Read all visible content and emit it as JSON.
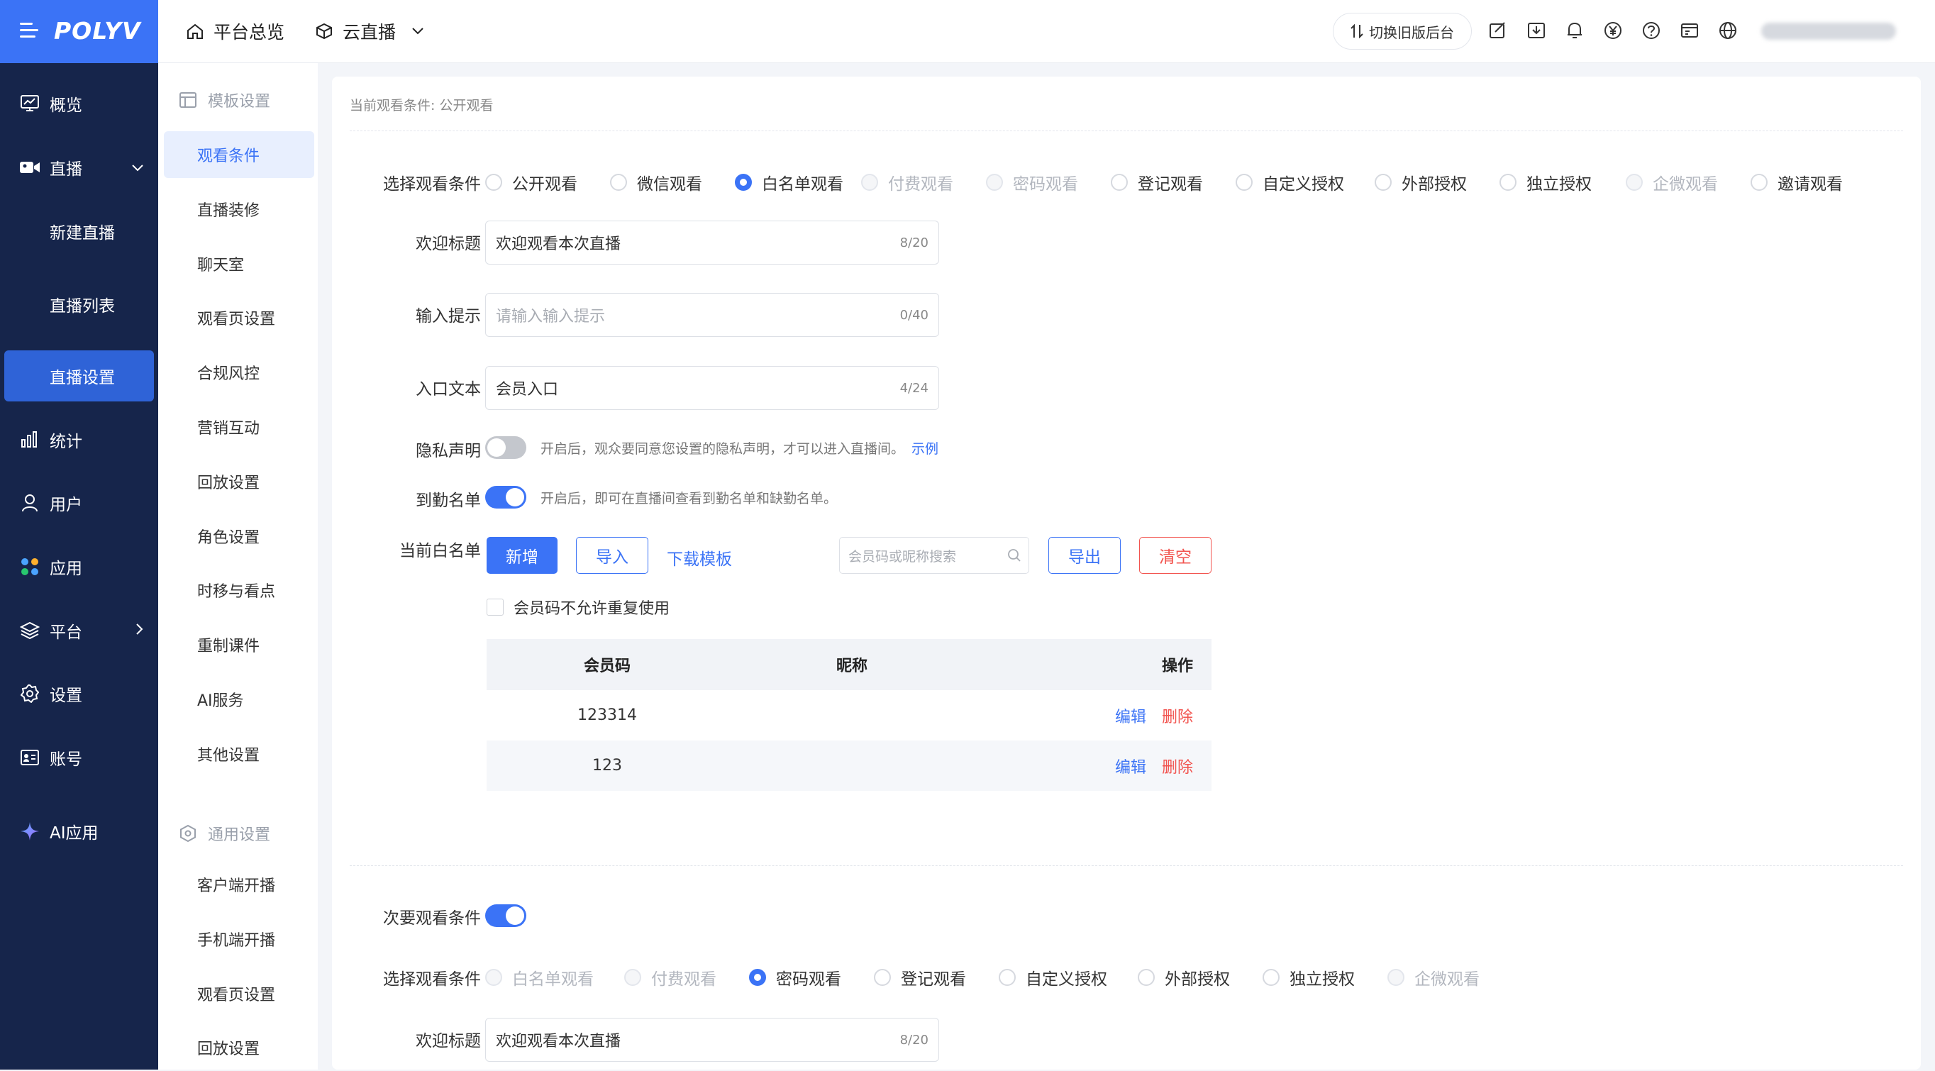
{
  "brand": {
    "name": "POLYV",
    "color": "#3b73f6"
  },
  "header": {
    "home_label": "平台总览",
    "product_label": "云直播",
    "switch_label": "切换旧版后台",
    "icons": [
      "edit-icon",
      "download-icon",
      "bell-icon",
      "yen-icon",
      "help-icon",
      "window-icon",
      "globe-icon"
    ]
  },
  "sidebar": {
    "items": [
      {
        "label": "概览",
        "icon": "monitor-icon"
      },
      {
        "label": "直播",
        "icon": "camera-icon"
      },
      {
        "label": "新建直播"
      },
      {
        "label": "直播列表"
      },
      {
        "label": "直播设置"
      },
      {
        "label": "统计",
        "icon": "chart-icon"
      },
      {
        "label": "用户",
        "icon": "user-icon"
      },
      {
        "label": "应用",
        "icon": "apps-icon"
      },
      {
        "label": "平台",
        "icon": "layers-icon"
      },
      {
        "label": "设置",
        "icon": "gear-icon"
      },
      {
        "label": "账号",
        "icon": "id-card-icon"
      },
      {
        "label": "AI应用",
        "icon": "sparkle-icon"
      }
    ]
  },
  "subnav": {
    "group1": "模板设置",
    "group1_items": [
      "观看条件",
      "直播装修",
      "聊天室",
      "观看页设置",
      "合规风控",
      "营销互动",
      "回放设置",
      "角色设置",
      "时移与看点",
      "重制课件",
      "AI服务",
      "其他设置"
    ],
    "group2": "通用设置",
    "group2_items": [
      "客户端开播",
      "手机端开播",
      "观看页设置",
      "回放设置"
    ]
  },
  "content": {
    "breadcrumb": "当前观看条件: 公开观看",
    "primary": {
      "select_label": "选择观看条件",
      "options": [
        {
          "label": "公开观看",
          "state": "normal"
        },
        {
          "label": "微信观看",
          "state": "normal"
        },
        {
          "label": "白名单观看",
          "state": "checked"
        },
        {
          "label": "付费观看",
          "state": "disabled"
        },
        {
          "label": "密码观看",
          "state": "disabled"
        },
        {
          "label": "登记观看",
          "state": "normal"
        },
        {
          "label": "自定义授权",
          "state": "normal"
        },
        {
          "label": "外部授权",
          "state": "normal"
        },
        {
          "label": "独立授权",
          "state": "normal"
        },
        {
          "label": "企微观看",
          "state": "disabled"
        },
        {
          "label": "邀请观看",
          "state": "normal"
        }
      ],
      "welcome_label": "欢迎标题",
      "welcome_value": "欢迎观看本次直播",
      "welcome_count": "8/20",
      "prompt_label": "输入提示",
      "prompt_placeholder": "请输入输入提示",
      "prompt_count": "0/40",
      "entry_label": "入口文本",
      "entry_value": "会员入口",
      "entry_count": "4/24",
      "privacy_label": "隐私声明",
      "privacy_on": false,
      "privacy_hint": "开启后，观众要同意您设置的隐私声明，才可以进入直播间。",
      "privacy_link": "示例",
      "attendance_label": "到勤名单",
      "attendance_on": true,
      "attendance_hint": "开启后，即可在直播间查看到勤名单和缺勤名单。",
      "whitelist_label": "当前白名单",
      "btn_add": "新增",
      "btn_import": "导入",
      "btn_download": "下载模板",
      "search_placeholder": "会员码或昵称搜索",
      "btn_export": "导出",
      "btn_clear": "清空",
      "no_repeat_label": "会员码不允许重复使用",
      "table": {
        "headers": [
          "会员码",
          "昵称",
          "操作"
        ],
        "rows": [
          {
            "code": "123314",
            "nick": "",
            "edit": "编辑",
            "del": "删除"
          },
          {
            "code": "123",
            "nick": "",
            "edit": "编辑",
            "del": "删除"
          }
        ]
      }
    },
    "secondary": {
      "toggle_label": "次要观看条件",
      "toggle_on": true,
      "select_label": "选择观看条件",
      "options": [
        {
          "label": "白名单观看",
          "state": "disabled"
        },
        {
          "label": "付费观看",
          "state": "disabled"
        },
        {
          "label": "密码观看",
          "state": "checked"
        },
        {
          "label": "登记观看",
          "state": "normal"
        },
        {
          "label": "自定义授权",
          "state": "normal"
        },
        {
          "label": "外部授权",
          "state": "normal"
        },
        {
          "label": "独立授权",
          "state": "normal"
        },
        {
          "label": "企微观看",
          "state": "disabled"
        }
      ],
      "welcome_label": "欢迎标题",
      "welcome_value": "欢迎观看本次直播",
      "welcome_count": "8/20"
    }
  }
}
